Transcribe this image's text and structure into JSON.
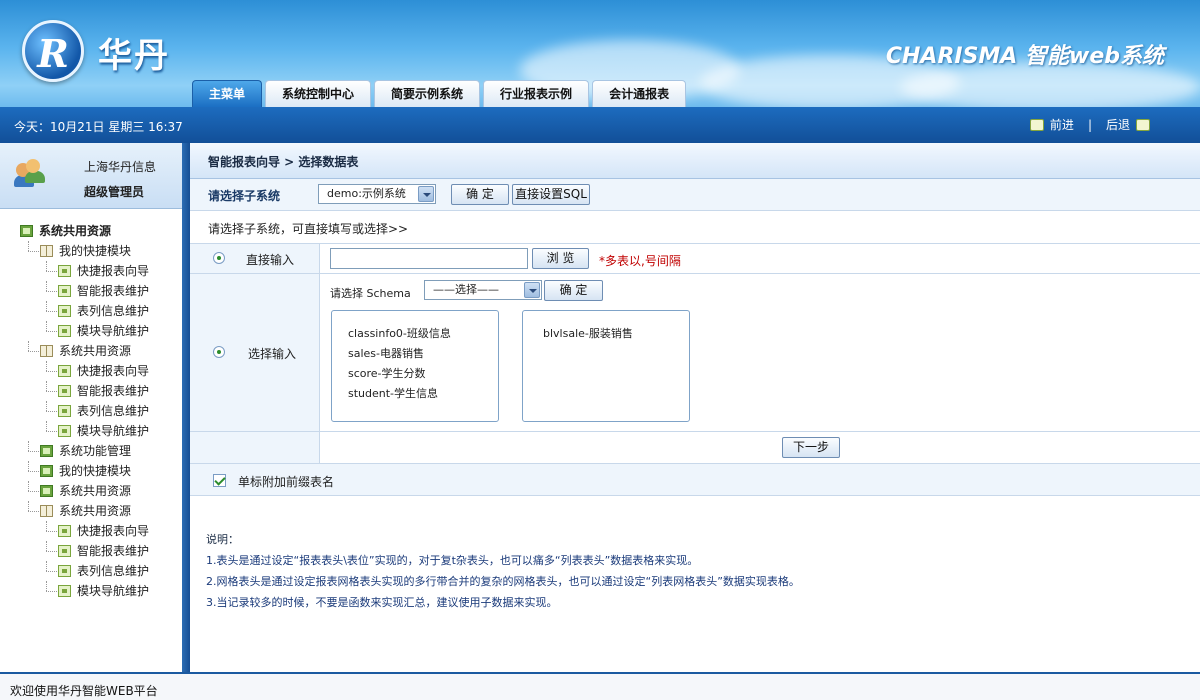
{
  "header": {
    "logo_text": "华丹",
    "brand": "CHARISMA 智能web系统",
    "tabs": [
      {
        "label": "主菜单",
        "active": true
      },
      {
        "label": "系统控制中心",
        "active": false
      },
      {
        "label": "简要示例系统",
        "active": false
      },
      {
        "label": "行业报表示例",
        "active": false
      },
      {
        "label": "会计通报表",
        "active": false
      }
    ]
  },
  "datebar": {
    "date": "今天：10月21日 星期三 16:37",
    "forward": "前进",
    "separator": "|",
    "back": "后退"
  },
  "user": {
    "org": "上海华丹信息",
    "role": "超级管理员"
  },
  "tree": [
    {
      "label": "系统共用资源",
      "level": 0,
      "icon": "folder-green-icon"
    },
    {
      "label": "我的快捷模块",
      "level": 1,
      "icon": "book-icon"
    },
    {
      "label": "快捷报表向导",
      "level": 2,
      "icon": "leaf-icon"
    },
    {
      "label": "智能报表维护",
      "level": 2,
      "icon": "leaf-icon"
    },
    {
      "label": "表列信息维护",
      "level": 2,
      "icon": "leaf-icon"
    },
    {
      "label": "模块导航维护",
      "level": 2,
      "icon": "leaf-icon"
    },
    {
      "label": "系统共用资源",
      "level": 1,
      "icon": "book-icon"
    },
    {
      "label": "快捷报表向导",
      "level": 2,
      "icon": "leaf-icon"
    },
    {
      "label": "智能报表维护",
      "level": 2,
      "icon": "leaf-icon"
    },
    {
      "label": "表列信息维护",
      "level": 2,
      "icon": "leaf-icon"
    },
    {
      "label": "模块导航维护",
      "level": 2,
      "icon": "leaf-icon"
    },
    {
      "label": "系统功能管理",
      "level": 1,
      "icon": "folder-green-icon"
    },
    {
      "label": "我的快捷模块",
      "level": 1,
      "icon": "folder-green-icon"
    },
    {
      "label": "系统共用资源",
      "level": 1,
      "icon": "folder-green-icon"
    },
    {
      "label": "系统共用资源",
      "level": 1,
      "icon": "book-icon"
    },
    {
      "label": "快捷报表向导",
      "level": 2,
      "icon": "leaf-icon"
    },
    {
      "label": "智能报表维护",
      "level": 2,
      "icon": "leaf-icon"
    },
    {
      "label": "表列信息维护",
      "level": 2,
      "icon": "leaf-icon"
    },
    {
      "label": "模块导航维护",
      "level": 2,
      "icon": "leaf-icon"
    }
  ],
  "main": {
    "breadcrumb": "智能报表向导 > 选择数据表",
    "subsystem_label": "请选择子系统",
    "subsystem_value": "demo:示例系统",
    "confirm_label": "确 定",
    "direct_sql_label": "直接设置SQL",
    "hint": "请选择子系统，可直接填写或选择>>",
    "direct_input": {
      "label": "直接输入",
      "value": "",
      "browse_label": "浏 览",
      "note": "*多表以,号间隔"
    },
    "select_input": {
      "label": "选择输入",
      "schema_label": "请选择 Schema",
      "schema_value": "——选择——",
      "confirm_label": "确 定",
      "left_list": [
        "classinfo0-班级信息",
        "sales-电器销售",
        "score-学生分数",
        "student-学生信息"
      ],
      "right_list": [
        "blvlsale-服装销售"
      ]
    },
    "next_label": "下一步",
    "prefix_checkbox_label": "单标附加前缀表名",
    "notes_title": "说明：",
    "notes": [
      "1.表头是通过设定“报表表头\\表位”实现的，对于复t杂表头，也可以痛多“列表表头”数据表格来实现。",
      "2.网格表头是通过设定报表网格表头实现的多行带合并的复杂的网格表头，也可以通过设定“列表网格表头”数据实现表格。",
      "3.当记录较多的时候，不要是函数来实现汇总，建议使用子数据来实现。"
    ]
  },
  "footer": {
    "text": "欢迎使用华丹智能WEB平台"
  },
  "colors": {
    "header_blue": "#2d8fd6",
    "bar_blue": "#124f98",
    "panel_bg": "#eef5fc",
    "note_red": "#c00000"
  }
}
